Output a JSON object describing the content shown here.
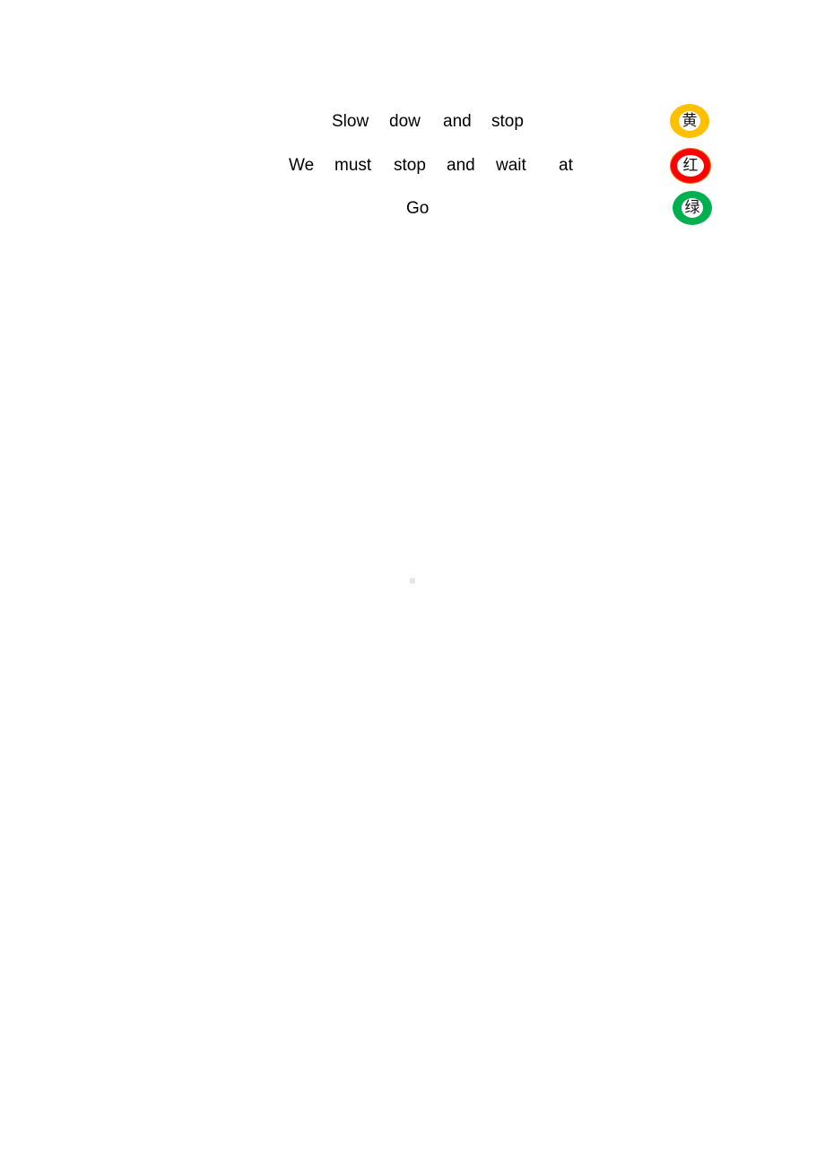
{
  "lines": [
    {
      "words": [
        "Slow",
        "dow",
        "and",
        "stop"
      ]
    },
    {
      "words": [
        "We",
        "must",
        "stop",
        "and",
        "wait",
        "at"
      ]
    },
    {
      "words": [
        "Go"
      ]
    }
  ],
  "lights": [
    {
      "label": "黄",
      "color": "#ffc000"
    },
    {
      "label": "红",
      "color": "#ff0000"
    },
    {
      "label": "绿",
      "color": "#00b050"
    }
  ]
}
